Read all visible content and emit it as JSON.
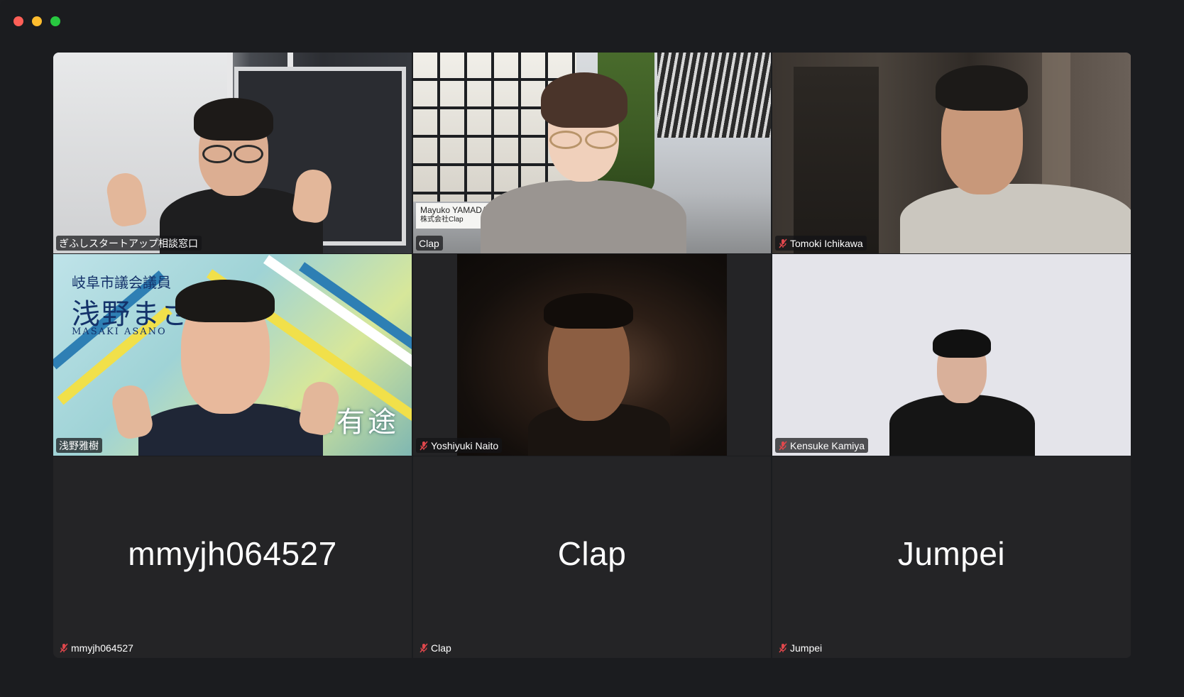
{
  "window": {
    "controls": [
      "close",
      "minimize",
      "maximize"
    ]
  },
  "participants": [
    {
      "name": "ぎふしスタートアップ相談窓口",
      "muted": false,
      "speaking": false,
      "video": true
    },
    {
      "name": "Clap",
      "muted": false,
      "speaking": true,
      "video": true,
      "background_sign": {
        "line1": "Mayuko YAMADA",
        "line2": "株式会社Clap"
      }
    },
    {
      "name": "Tomoki Ichikawa",
      "muted": true,
      "speaking": false,
      "video": true
    },
    {
      "name": "浅野雅樹",
      "muted": false,
      "speaking": false,
      "video": true,
      "background": {
        "title_small": "岐阜市議会議員",
        "title_large": "浅野まさき",
        "romaji": "MASAKI ASANO",
        "slogan": "有志有途"
      }
    },
    {
      "name": "Yoshiyuki Naito",
      "muted": true,
      "speaking": false,
      "video": true
    },
    {
      "name": "Kensuke Kamiya",
      "muted": true,
      "speaking": false,
      "video": true
    },
    {
      "name": "mmyjh064527",
      "display_name": "mmyjh064527",
      "muted": true,
      "speaking": false,
      "video": false
    },
    {
      "name": "Clap",
      "display_name": "Clap",
      "muted": true,
      "speaking": false,
      "video": false
    },
    {
      "name": "Jumpei",
      "display_name": "Jumpei",
      "muted": true,
      "speaking": false,
      "video": false
    }
  ],
  "icons": {
    "muted": "mic-off-icon"
  },
  "colors": {
    "speaking_border": "#4ccd55",
    "mute_icon": "#e0474c",
    "background": "#1b1c1f",
    "tile": "#242426"
  }
}
